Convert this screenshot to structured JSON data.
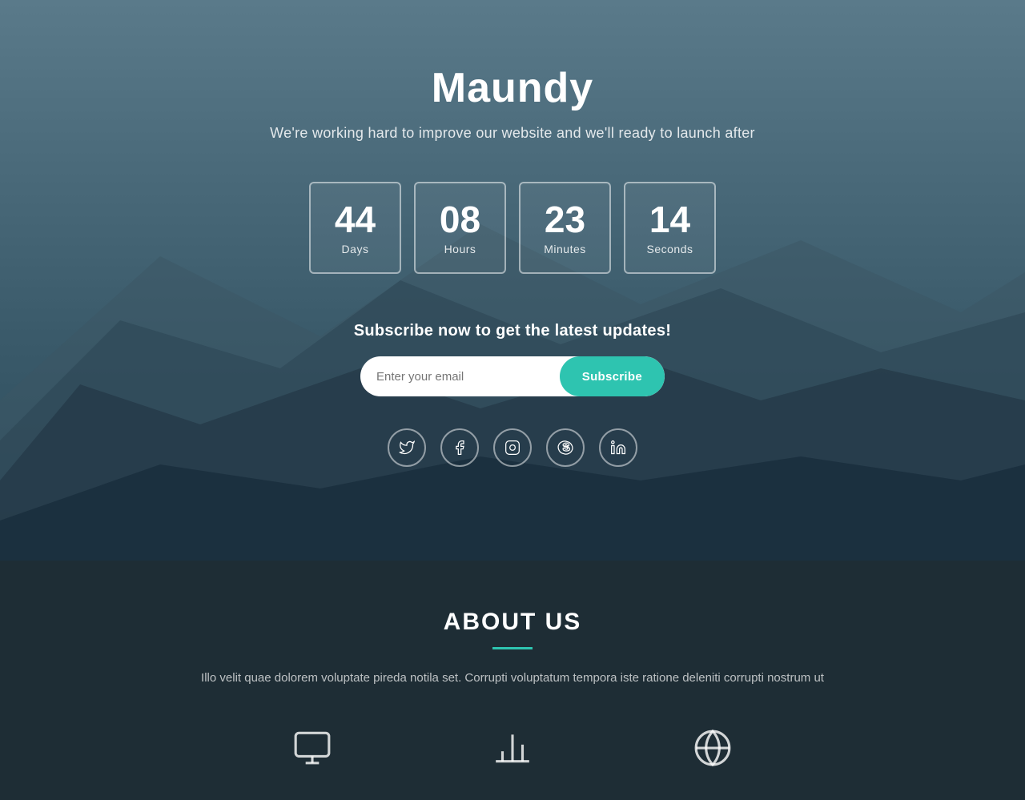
{
  "hero": {
    "title": "Maundy",
    "subtitle": "We're working hard to improve our website and we'll ready to launch after",
    "countdown": {
      "days": {
        "value": "44",
        "label": "Days"
      },
      "hours": {
        "value": "08",
        "label": "Hours"
      },
      "minutes": {
        "value": "23",
        "label": "Minutes"
      },
      "seconds": {
        "value": "14",
        "label": "Seconds"
      }
    },
    "subscribe": {
      "heading": "Subscribe now to get the latest updates!",
      "input_placeholder": "Enter your email",
      "button_label": "Subscribe"
    },
    "social": {
      "twitter": "𝕏",
      "facebook": "f",
      "instagram": "◎",
      "skype": "s",
      "linkedin": "in"
    }
  },
  "about": {
    "title": "ABOUT US",
    "body_text": "Illo velit quae dolorem voluptate pireda notila set. Corrupti voluptatum tempora iste ratione deleniti corrupti nostrum ut"
  }
}
